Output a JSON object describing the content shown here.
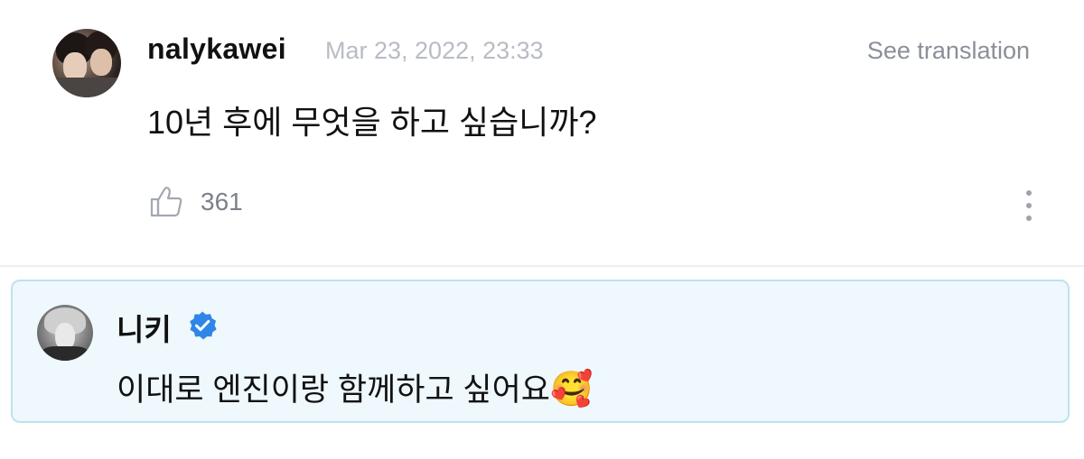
{
  "post": {
    "username": "nalykawei",
    "timestamp": "Mar 23, 2022, 23:33",
    "translate_label": "See translation",
    "text": "10년 후에 무엇을 하고 싶습니까?",
    "like_count": "361",
    "icons": {
      "like": "thumbs-up-icon",
      "more": "more-vertical-icon"
    }
  },
  "reply": {
    "username": "니키",
    "verified": true,
    "text": "이대로 엔진이랑 함께하고 싶어요",
    "emoji": "🥰",
    "icons": {
      "verified": "verified-badge-icon"
    }
  },
  "colors": {
    "reply_background": "#eef8fd",
    "reply_border": "#bfe1f0",
    "verified_blue": "#2f86e8",
    "muted_text": "#8a8f98",
    "timestamp_text": "#b8bcc4"
  }
}
